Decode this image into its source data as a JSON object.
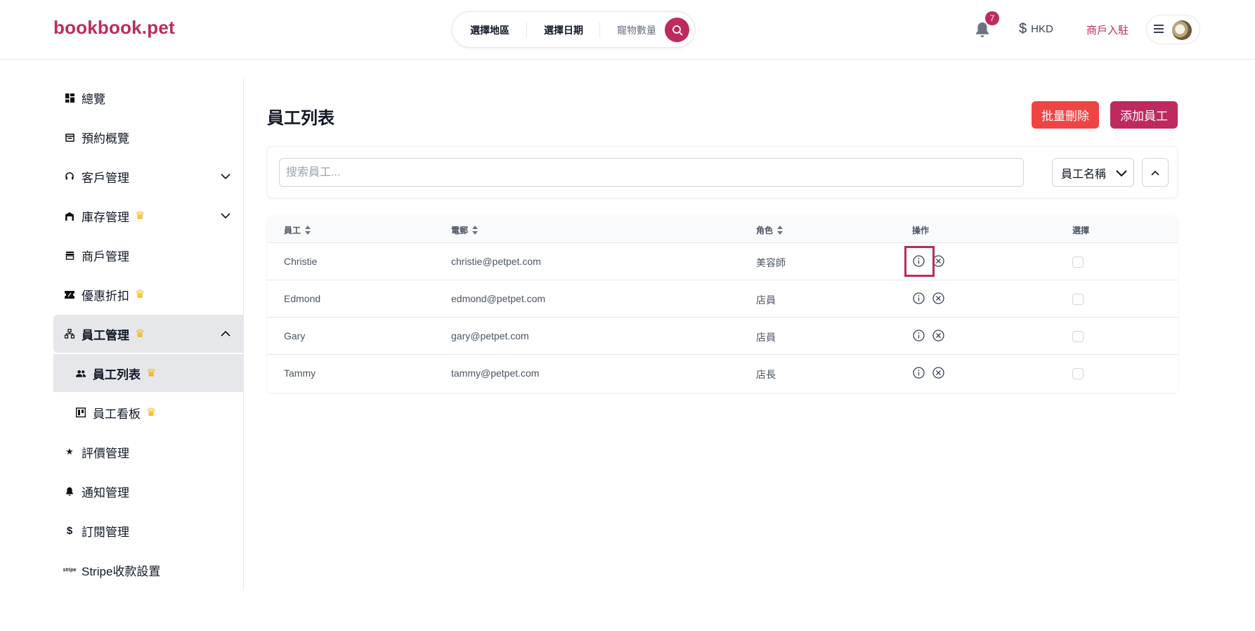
{
  "header": {
    "logo": "bookbook.pet",
    "search": {
      "region": "選擇地區",
      "date": "選擇日期",
      "pets": "寵物數量"
    },
    "notification_count": "7",
    "currency": "HKD",
    "merchant_link": "商戶入駐"
  },
  "sidebar": {
    "items": [
      {
        "label": "總覽",
        "icon": "dashboard-icon"
      },
      {
        "label": "預約概覽",
        "icon": "calendar-icon"
      },
      {
        "label": "客戶管理",
        "icon": "headset-icon"
      },
      {
        "label": "庫存管理",
        "icon": "warehouse-icon"
      },
      {
        "label": "商戶管理",
        "icon": "store-icon"
      },
      {
        "label": "優惠折扣",
        "icon": "ticket-icon"
      },
      {
        "label": "員工管理",
        "icon": "org-icon"
      },
      {
        "label": "員工列表",
        "icon": "users-icon"
      },
      {
        "label": "員工看板",
        "icon": "board-icon"
      },
      {
        "label": "評價管理",
        "icon": "star-icon"
      },
      {
        "label": "通知管理",
        "icon": "bell-icon"
      },
      {
        "label": "訂閱管理",
        "icon": "dollar-icon"
      },
      {
        "label": "Stripe收款設置",
        "icon": "stripe-icon"
      }
    ]
  },
  "main": {
    "title": "員工列表",
    "bulk_delete": "批量刪除",
    "add_staff": "添加員工",
    "search_placeholder": "搜索員工...",
    "sort_field": "員工名稱",
    "columns": {
      "staff": "員工",
      "email": "電郵",
      "role": "角色",
      "actions": "操作",
      "select": "選擇"
    },
    "rows": [
      {
        "name": "Christie",
        "email": "christie@petpet.com",
        "role": "美容師"
      },
      {
        "name": "Edmond",
        "email": "edmond@petpet.com",
        "role": "店員"
      },
      {
        "name": "Gary",
        "email": "gary@petpet.com",
        "role": "店員"
      },
      {
        "name": "Tammy",
        "email": "tammy@petpet.com",
        "role": "店長"
      }
    ]
  },
  "colors": {
    "brand": "#be2a5f",
    "danger": "#ef4444",
    "crown": "#f5b100"
  }
}
